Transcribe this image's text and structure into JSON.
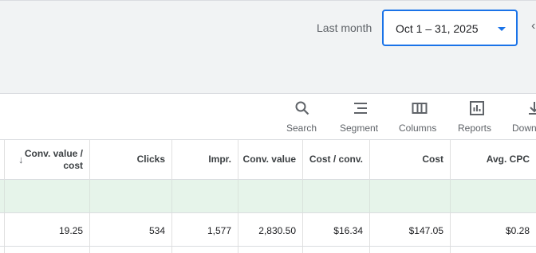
{
  "date_range": {
    "label": "Last month",
    "value": "Oct 1 – 31, 2025"
  },
  "toolbar": {
    "search": "Search",
    "segment": "Segment",
    "columns": "Columns",
    "reports": "Reports",
    "download": "Down"
  },
  "table": {
    "headers": {
      "conv_value_cost": "Conv. value / cost",
      "clicks": "Clicks",
      "impr": "Impr.",
      "conv_value": "Conv. value",
      "cost_per_conv": "Cost / conv.",
      "cost": "Cost",
      "avg_cpc": "Avg. CPC"
    },
    "row": {
      "conv_value_cost": "19.25",
      "clicks": "534",
      "impr": "1,577",
      "conv_value": "2,830.50",
      "cost_per_conv": "$16.34",
      "cost": "$147.05",
      "avg_cpc": "$0.28"
    }
  },
  "colors": {
    "accent": "#1a73e8",
    "summary_row": "#e6f4ea"
  }
}
